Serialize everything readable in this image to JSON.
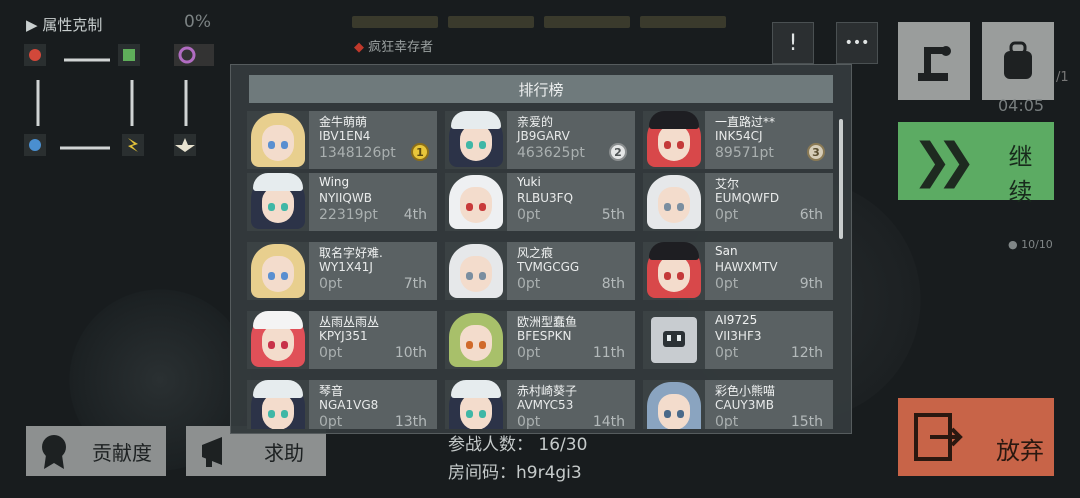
{
  "hud": {
    "attr_label": "属性克制",
    "attr_percent": "0%",
    "survivor_label": "疯狂幸存者",
    "pvp_icon": "!",
    "chat_icon": "•••",
    "time": "04:05",
    "count": "10/10",
    "ratio": "/1"
  },
  "buttons": {
    "continue_label": "继续",
    "giveup_label": "放弃",
    "contribution_label": "贡献度",
    "help_label": "求助"
  },
  "room": {
    "players_label": "参战人数：",
    "players_value": "16/30",
    "room_code_label": "房间码：",
    "room_code_value": "h9r4gi3"
  },
  "leaderboard": {
    "title": "排行榜",
    "entries": [
      {
        "name": "金牛萌萌",
        "code": "IBV1EN4",
        "pts": "1348126pt",
        "rank": "1",
        "medal": "1",
        "avatar": "blonde"
      },
      {
        "name": "亲爱的",
        "code": "JB9GARV",
        "pts": "463625pt",
        "rank": "2",
        "medal": "2",
        "avatar": "navycap"
      },
      {
        "name": "一直路过**",
        "code": "INK54CJ",
        "pts": "89571pt",
        "rank": "3",
        "medal": "3",
        "avatar": "redcap"
      },
      {
        "name": "Wing",
        "code": "NYIIQWB",
        "pts": "22319pt",
        "rank": "4th",
        "avatar": "navycap"
      },
      {
        "name": "Yuki",
        "code": "RLBU3FQ",
        "pts": "0pt",
        "rank": "5th",
        "avatar": "whitehorn"
      },
      {
        "name": "艾尔",
        "code": "EUMQWFD",
        "pts": "0pt",
        "rank": "6th",
        "avatar": "white"
      },
      {
        "name": "取名字好难.",
        "code": "WY1X41J",
        "pts": "0pt",
        "rank": "7th",
        "avatar": "blonde"
      },
      {
        "name": "风之痕",
        "code": "TVMGCGG",
        "pts": "0pt",
        "rank": "8th",
        "avatar": "white"
      },
      {
        "name": "San",
        "code": "HAWXMTV",
        "pts": "0pt",
        "rank": "9th",
        "avatar": "redcap"
      },
      {
        "name": "丛雨丛雨丛",
        "code": "KPYJ351",
        "pts": "0pt",
        "rank": "10th",
        "avatar": "redmaid"
      },
      {
        "name": "欧洲型蠢鱼",
        "code": "BFESPKN",
        "pts": "0pt",
        "rank": "11th",
        "avatar": "green"
      },
      {
        "name": "AI9725",
        "code": "VII3HF3",
        "pts": "0pt",
        "rank": "12th",
        "avatar": "robot"
      },
      {
        "name": "琴音",
        "code": "NGA1VG8",
        "pts": "0pt",
        "rank": "13th",
        "avatar": "navycap"
      },
      {
        "name": "赤村崎葵子",
        "code": "AVMYC53",
        "pts": "0pt",
        "rank": "14th",
        "avatar": "navycap"
      },
      {
        "name": "彩色小熊喵",
        "code": "CAUY3MB",
        "pts": "0pt",
        "rank": "15th",
        "avatar": "bluehair"
      }
    ]
  }
}
